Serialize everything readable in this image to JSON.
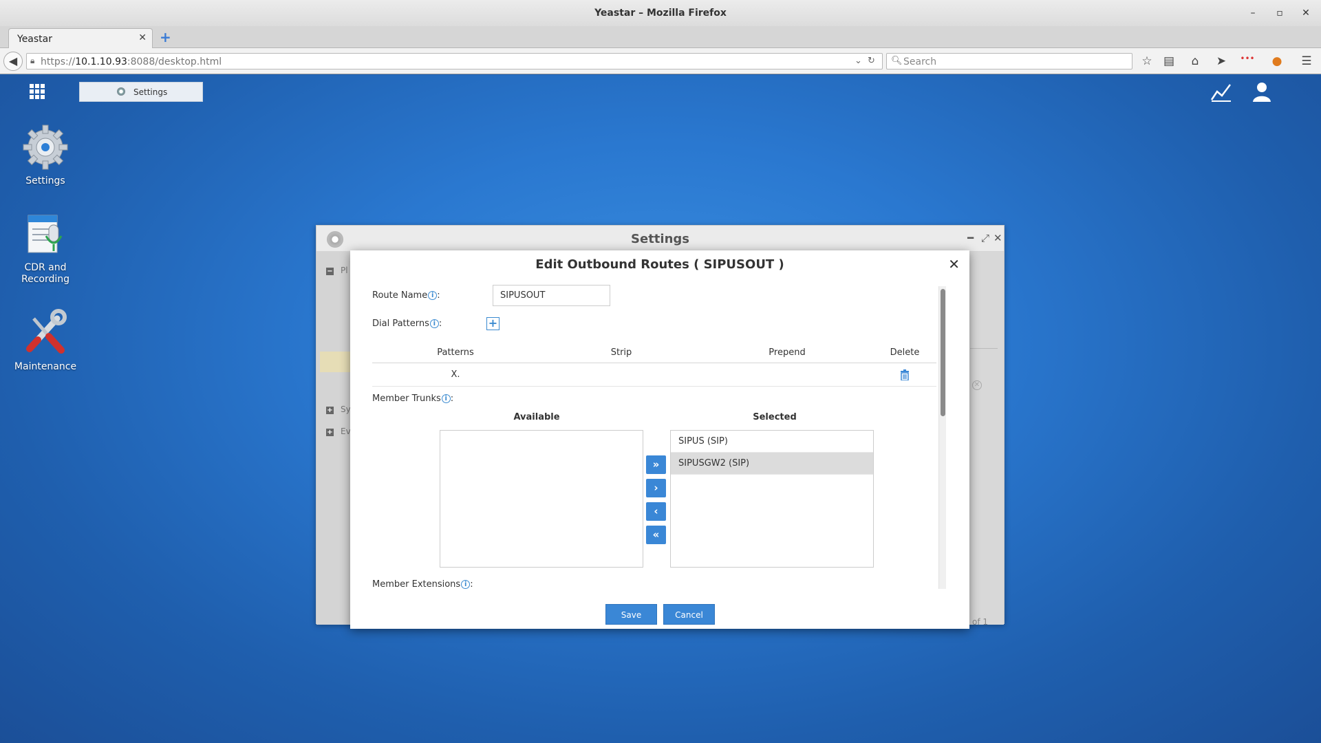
{
  "browser": {
    "window_title": "Yeastar – Mozilla Firefox",
    "tab_title": "Yeastar",
    "url_prefix": "https://",
    "url_host": "10.1.10.93",
    "url_rest": ":8088/desktop.html",
    "search_placeholder": "Search"
  },
  "taskbar": {
    "settings_label": "Settings"
  },
  "desktop_icons": [
    {
      "label": "Settings"
    },
    {
      "label": "CDR and Recording"
    },
    {
      "label": "Maintenance"
    }
  ],
  "settings_window": {
    "title": "Settings",
    "section_1": "Pl",
    "section_2": "Sy",
    "section_3": "Ev",
    "page_of": "of 1"
  },
  "dialog": {
    "title": "Edit Outbound Routes ( SIPUSOUT )",
    "route_name_label": "Route Name",
    "route_name_value": "SIPUSOUT",
    "dial_patterns_label": "Dial Patterns",
    "columns": [
      "Patterns",
      "Strip",
      "Prepend",
      "Delete"
    ],
    "patterns": [
      {
        "pattern": "X.",
        "strip": "",
        "prepend": ""
      }
    ],
    "member_trunks_label": "Member Trunks",
    "available_title": "Available",
    "selected_title": "Selected",
    "available_trunks": [],
    "selected_trunks": [
      "SIPUS (SIP)",
      "SIPUSGW2 (SIP)"
    ],
    "highlighted_selected_index": 1,
    "member_extensions_label": "Member Extensions",
    "save_label": "Save",
    "cancel_label": "Cancel"
  },
  "colors": {
    "accent": "#3a87d6",
    "desktop_bg": "#2a78d0"
  }
}
